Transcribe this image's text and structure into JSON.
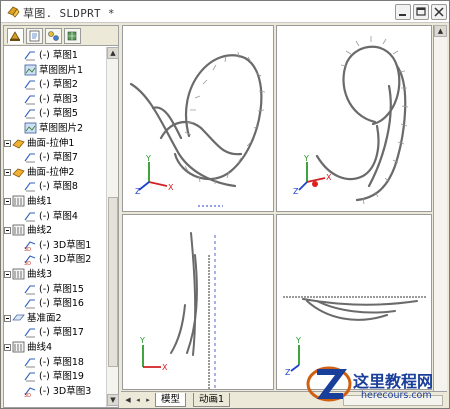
{
  "window": {
    "title": "草图. SLDPRT *"
  },
  "feature_tabs": [
    {
      "icon": "feature-manager-icon"
    },
    {
      "icon": "property-manager-icon"
    },
    {
      "icon": "configuration-manager-icon"
    },
    {
      "icon": "dimxpert-icon"
    }
  ],
  "tree": {
    "items": [
      {
        "label": "(-) 草图1",
        "icon": "sketch-icon"
      },
      {
        "label": "草图图片1",
        "icon": "sketch-picture-icon"
      },
      {
        "label": "(-) 草图2",
        "icon": "sketch-icon"
      },
      {
        "label": "(-) 草图3",
        "icon": "sketch-icon"
      },
      {
        "label": "(-) 草图5",
        "icon": "sketch-icon"
      },
      {
        "label": "草图图片2",
        "icon": "sketch-picture-icon"
      },
      {
        "label": "曲面-拉伸1",
        "icon": "surface-extrude-icon"
      },
      {
        "label": "(-) 草图7",
        "icon": "sketch-icon"
      },
      {
        "label": "曲面-拉伸2",
        "icon": "surface-extrude-icon"
      },
      {
        "label": "(-) 草图8",
        "icon": "sketch-icon"
      },
      {
        "label": "曲线1",
        "icon": "curve-icon"
      },
      {
        "label": "(-) 草图4",
        "icon": "sketch-icon"
      },
      {
        "label": "曲线2",
        "icon": "curve-icon"
      },
      {
        "label": "(-) 3D草图1",
        "icon": "3d-sketch-icon"
      },
      {
        "label": "(-) 3D草图2",
        "icon": "3d-sketch-icon"
      },
      {
        "label": "曲线3",
        "icon": "curve-icon"
      },
      {
        "label": "(-) 草图15",
        "icon": "sketch-icon"
      },
      {
        "label": "(-) 草图16",
        "icon": "sketch-icon"
      },
      {
        "label": "基准面2",
        "icon": "plane-icon"
      },
      {
        "label": "(-) 草图17",
        "icon": "sketch-icon"
      },
      {
        "label": "曲线4",
        "icon": "curve-icon"
      },
      {
        "label": "(-) 草图18",
        "icon": "sketch-icon"
      },
      {
        "label": "(-) 草图19",
        "icon": "sketch-icon"
      },
      {
        "label": "(-) 3D草图3",
        "icon": "3d-sketch-icon"
      }
    ]
  },
  "tabs": {
    "model": "模型",
    "motion": "动画1"
  },
  "triad": {
    "x": "X",
    "y": "Y",
    "z": "Z"
  },
  "watermark": {
    "title": "这里教程网",
    "url": "herecours.com"
  }
}
